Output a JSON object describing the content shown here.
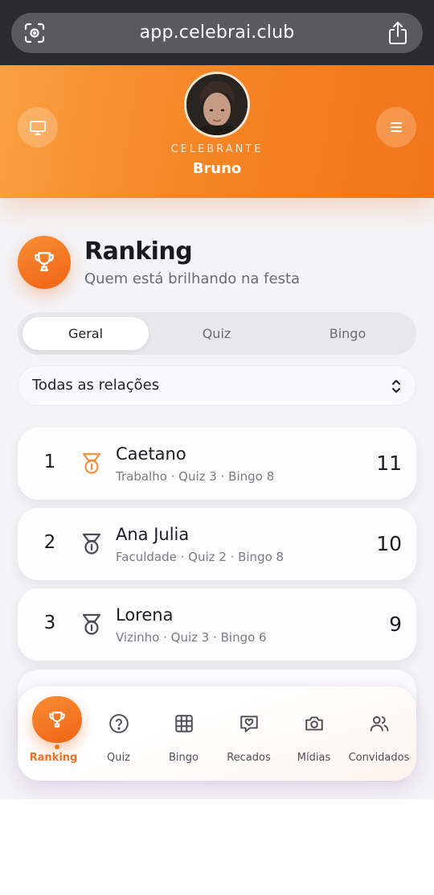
{
  "browser": {
    "url": "app.celebrai.club",
    "icons": [
      "lens-icon",
      "share-icon"
    ]
  },
  "header": {
    "left_button_icon": "monitor-icon",
    "right_button_icon": "menu-icon",
    "role_label": "CELEBRANTE",
    "name": "Bruno"
  },
  "page": {
    "icon": "trophy-icon",
    "title": "Ranking",
    "subtitle": "Quem está brilhando na festa"
  },
  "tabs": [
    {
      "label": "Geral",
      "active": true
    },
    {
      "label": "Quiz",
      "active": false
    },
    {
      "label": "Bingo",
      "active": false
    }
  ],
  "filter": {
    "selected": "Todas as relações"
  },
  "ranking": [
    {
      "position": "1",
      "name": "Caetano",
      "meta": "Trabalho · Quiz 3 · Bingo 8",
      "score": "11",
      "medal": "gold"
    },
    {
      "position": "2",
      "name": "Ana Julia",
      "meta": "Faculdade · Quiz 2 · Bingo 8",
      "score": "10",
      "medal": "silver"
    },
    {
      "position": "3",
      "name": "Lorena",
      "meta": "Vizinho · Quiz 3 · Bingo 6",
      "score": "9",
      "medal": "bronze"
    }
  ],
  "nav": [
    {
      "label": "Ranking",
      "icon": "trophy-icon",
      "active": true
    },
    {
      "label": "Quiz",
      "icon": "question-circle-icon",
      "active": false
    },
    {
      "label": "Bingo",
      "icon": "grid-icon",
      "active": false
    },
    {
      "label": "Recados",
      "icon": "message-heart-icon",
      "active": false
    },
    {
      "label": "Mídias",
      "icon": "camera-icon",
      "active": false
    },
    {
      "label": "Convidados",
      "icon": "users-icon",
      "active": false
    }
  ],
  "colors": {
    "accent": "#f27619",
    "medal_gold": "#f5913a",
    "medal_other": "#4a4a58",
    "background": "#f4f4f7"
  }
}
